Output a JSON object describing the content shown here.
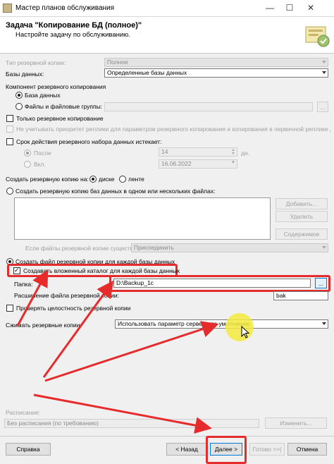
{
  "window": {
    "title": "Мастер планов обслуживания"
  },
  "header": {
    "title": "Задача \"Копирование БД (полное)\"",
    "subtitle": "Настройте задачу по обслуживанию."
  },
  "form": {
    "backup_type_label": "Тип резервной копии:",
    "backup_type_value": "Полное",
    "databases_label": "Базы данных:",
    "databases_value": "Определенные базы данных",
    "component_label": "Компонент резервного копирования",
    "component_db": "База данных",
    "component_files": "Файлы и файловые группы:",
    "copy_only": "Только резервное копирование",
    "ignore_replica": "Не учитывать приоритет реплики для параметров резервного копирования и копирования в первичной реплике для баз",
    "expire_label": "Срок действия резервного набора данных истекает:",
    "after_label": "После",
    "after_value": "14",
    "after_unit": "дн.",
    "on_label": "Вкл.",
    "on_value": "16.06.2022",
    "backup_to_label": "Создать резервную копию на:",
    "disk_label": "диске",
    "tape_label": "ленте",
    "across_files": "Создать резервную копию баз данных в одном или нескольких файлах:",
    "add_btn": "Добавить...",
    "remove_btn": "Удалить",
    "contents_btn": "Содержимое",
    "if_exists_label": "Если файлы резервной копии существуют:",
    "if_exists_value": "Присоединить",
    "file_per_db": "Создать файл резервной копии для каждой базы данных",
    "subdir": "Создавать вложенный каталог для каждой базы данных",
    "folder_label": "Папка:",
    "folder_value": "D:\\Backup_1c",
    "browse_btn": "...",
    "ext_label": "Расширение файла резервной копии:",
    "ext_value": "bak",
    "verify": "Проверять целостность резервной копии",
    "compress_label": "Сжимать резервные копии:",
    "compress_value": "Использовать параметр сервера по умолчанию"
  },
  "schedule": {
    "label": "Расписание:",
    "value": "Без расписания (по требованию)",
    "change_btn": "Изменить..."
  },
  "footer": {
    "help": "Справка",
    "back": "< Назад",
    "next": "Далее >",
    "finish": "Готово >>|",
    "cancel": "Отмена"
  },
  "colors": {
    "annotation": "#e52b2b",
    "cursor_highlight": "#f3ea3c"
  }
}
